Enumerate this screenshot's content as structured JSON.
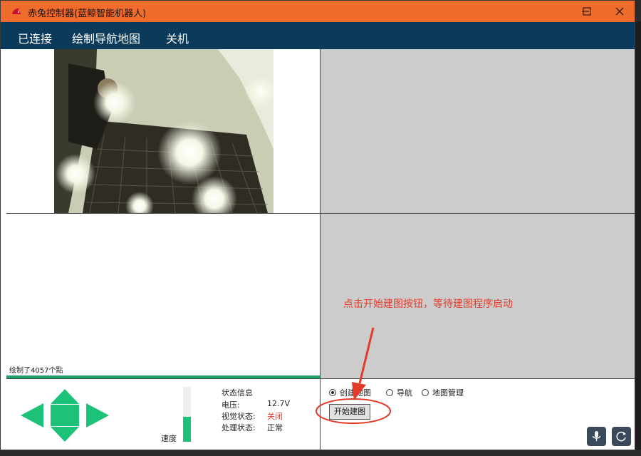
{
  "window": {
    "title": "赤兔控制器(蓝鲸智能机器人)"
  },
  "menu": {
    "items": [
      "已连接",
      "绘制导航地图",
      "关机"
    ]
  },
  "map_panel": {
    "points_text": "绘制了4057个點",
    "progress": 1.0
  },
  "controls": {
    "speed_label": "速度",
    "speed_level": 0.45
  },
  "status": {
    "heading": "状态信息",
    "voltage_label": "电压:",
    "voltage_value": "12.7V",
    "vision_label": "视觉状态:",
    "vision_value": "关闭",
    "process_label": "处理状态:",
    "process_value": "正常"
  },
  "mode": {
    "options": [
      "创建地图",
      "导航",
      "地图管理"
    ],
    "selected": "创建地图",
    "start_button": "开始建图"
  },
  "annotation": {
    "text": "点击开始建图按钮，等待建图程序启动"
  },
  "colors": {
    "titlebar": "#ef6c2c",
    "menubar": "#0b3a5a",
    "accent_green": "#1cc277",
    "annotation_red": "#e23b2a"
  },
  "icons": {
    "app": "rabbit-icon",
    "mic": "microphone-icon",
    "refresh": "refresh-icon"
  }
}
